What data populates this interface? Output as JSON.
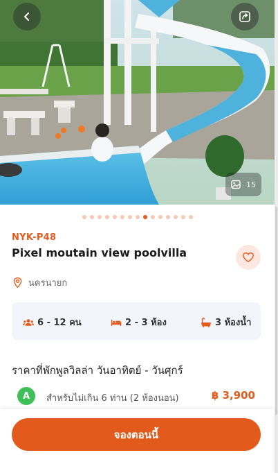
{
  "colors": {
    "accent": "#e25a1c",
    "badge_green": "#3ebf57",
    "specs_bg": "#f2f5fb",
    "fav_bg": "#fde8e1"
  },
  "hero": {
    "photo_count": "15",
    "back_icon": "chevron-left-icon",
    "share_icon": "share-icon",
    "gallery_icon": "image-icon",
    "dot_count": 15,
    "active_dot": 8
  },
  "listing": {
    "code": "NYK-P48",
    "title": "Pixel moutain view poolvilla",
    "location": "นครนายก",
    "favorite_icon": "heart-outline-icon"
  },
  "specs": {
    "guests": "6 - 12 คน",
    "bedrooms": "2 - 3 ห้อง",
    "bathrooms": "3 ห้องน้ำ"
  },
  "pricing": {
    "heading": "ราคาที่พักพูลวิลล่า วันอาทิตย์ - วันศุกร์",
    "tier_badge": "A",
    "tier_desc": "สำหรับไม่เกิน 6 ท่าน (2 ห้องนอน)",
    "tier_price": "฿ 3,900"
  },
  "footer": {
    "book_label": "จองตอนนี้"
  }
}
